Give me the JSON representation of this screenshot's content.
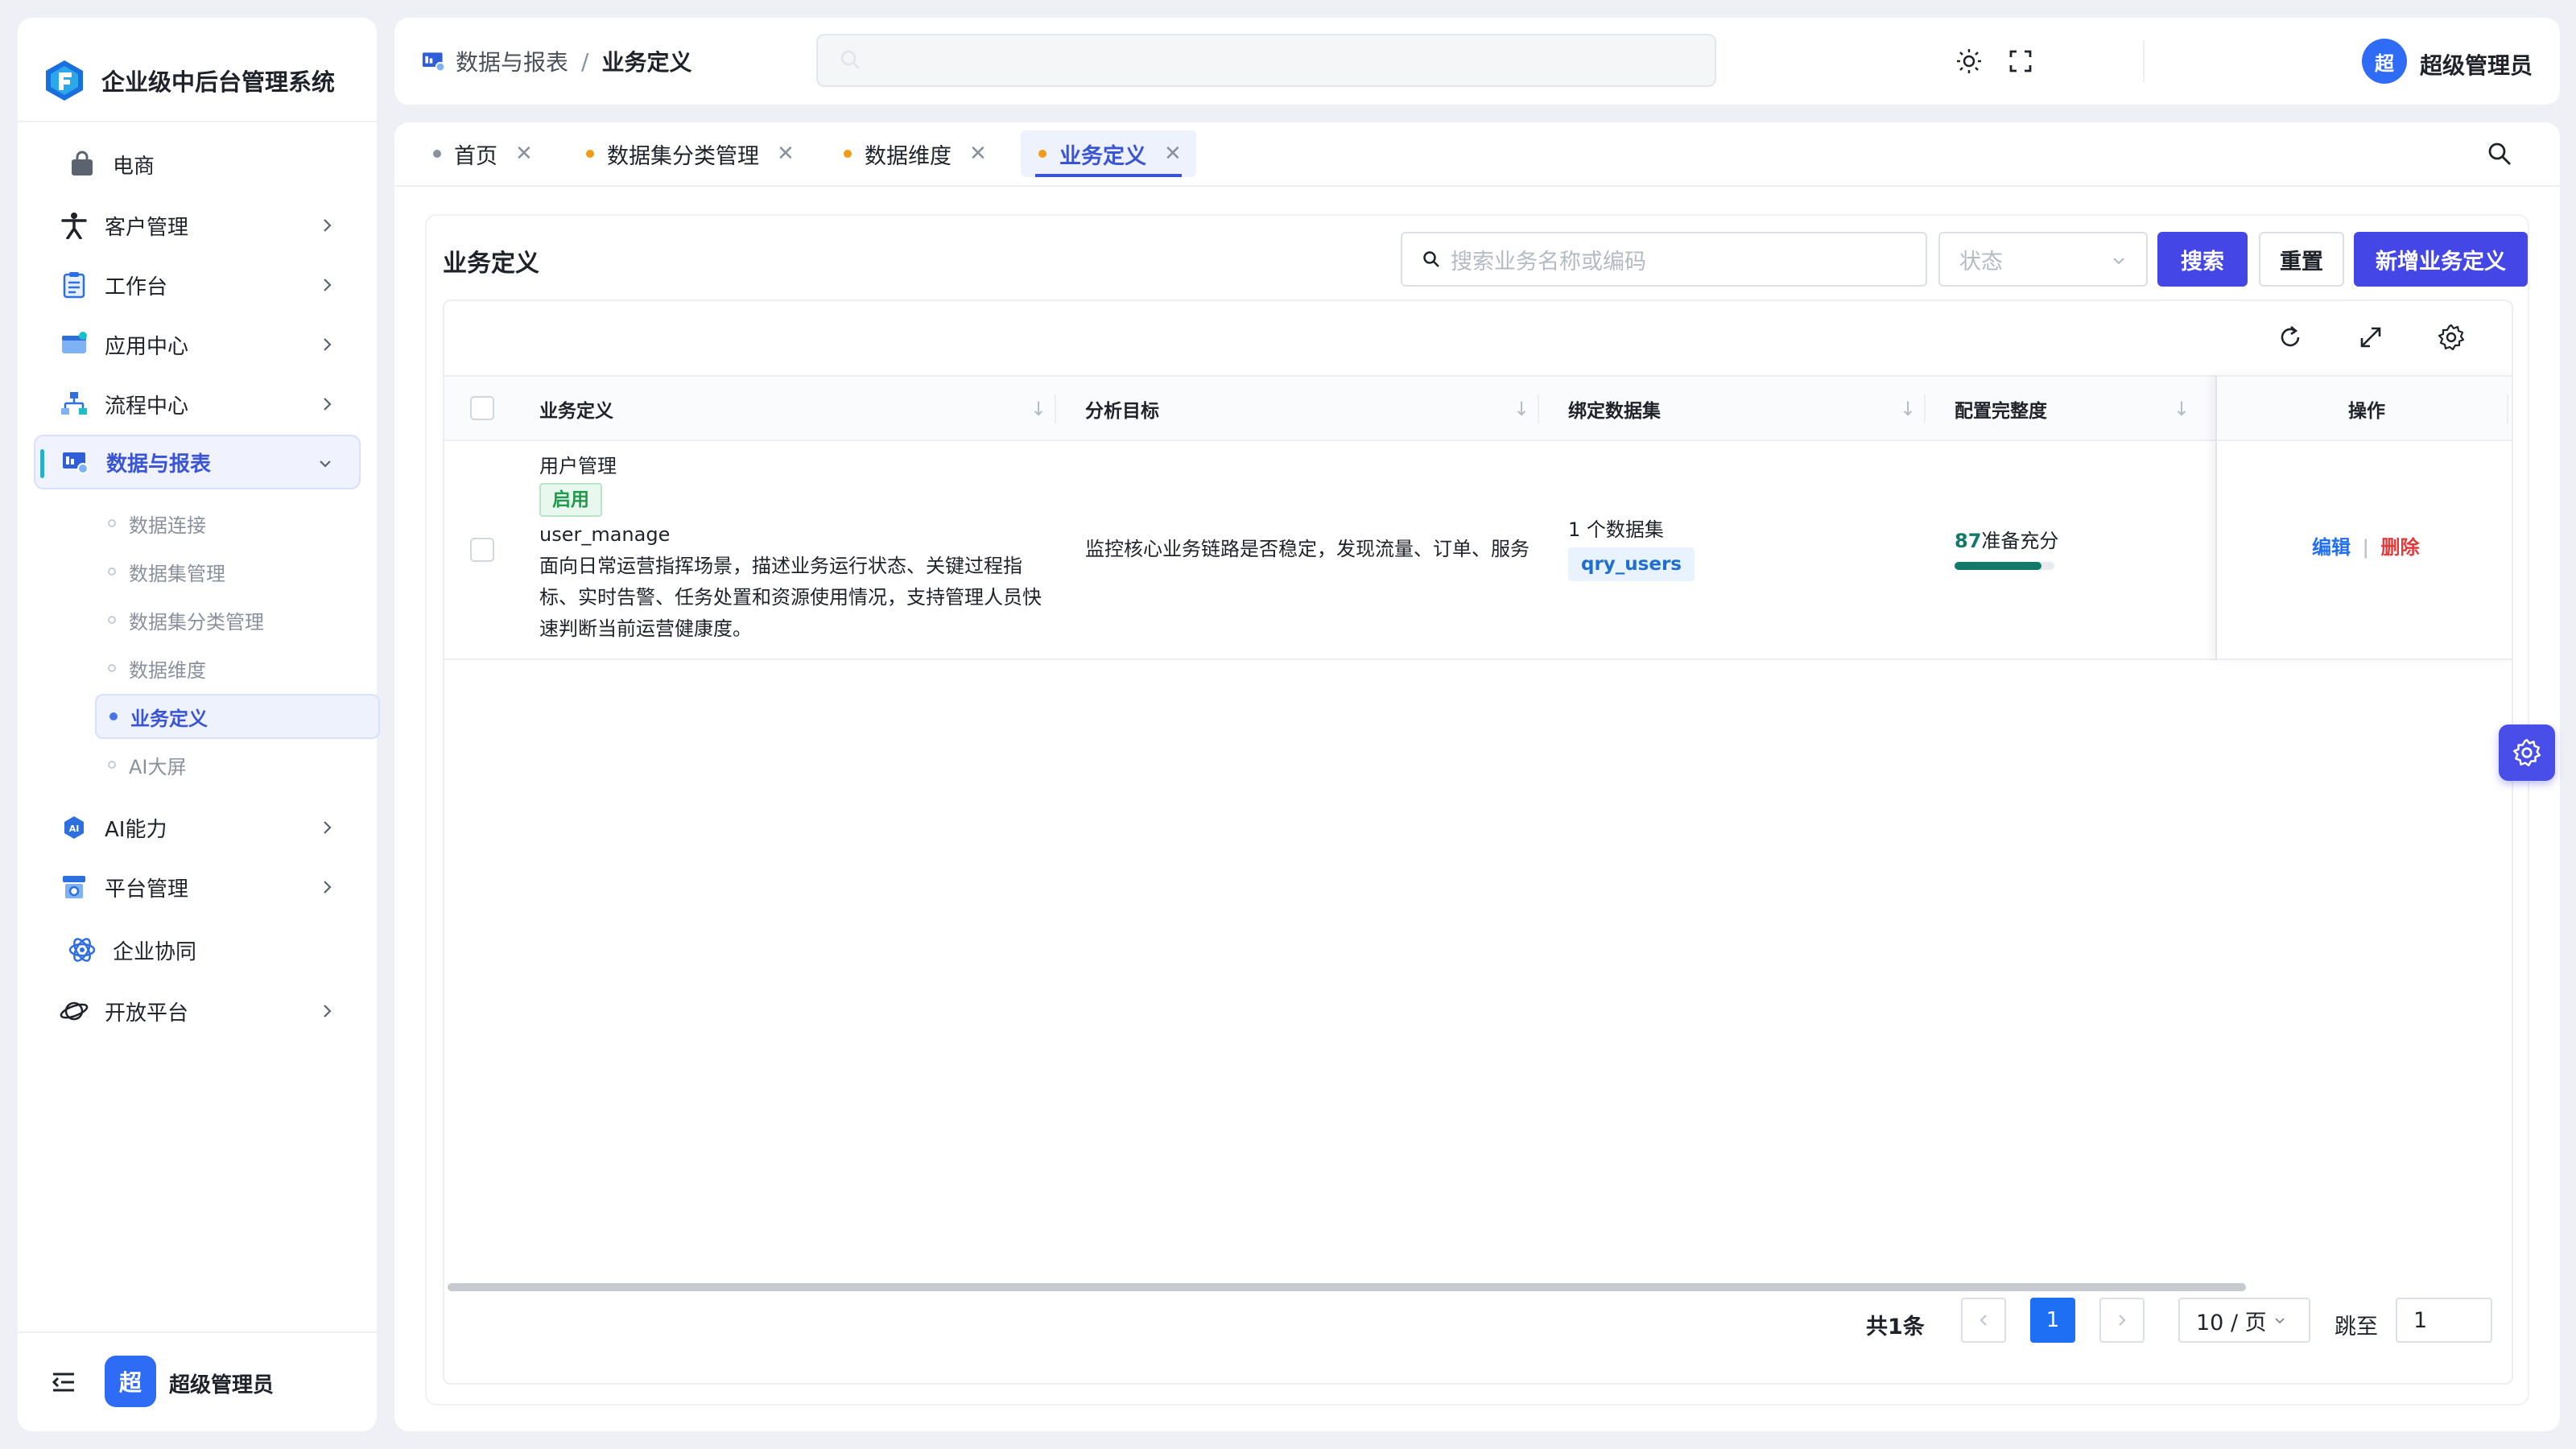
{
  "app": {
    "title": "企业级中后台管理系统"
  },
  "sidebar": {
    "items": [
      {
        "label": "电商",
        "icon": "shopping-bag-icon"
      },
      {
        "label": "客户管理",
        "icon": "person-icon"
      },
      {
        "label": "工作台",
        "icon": "clipboard-icon"
      },
      {
        "label": "应用中心",
        "icon": "app-window-icon"
      },
      {
        "label": "流程中心",
        "icon": "flow-icon"
      },
      {
        "label": "数据与报表",
        "icon": "report-icon"
      },
      {
        "label": "AI能力",
        "icon": "ai-icon"
      },
      {
        "label": "平台管理",
        "icon": "platform-icon"
      },
      {
        "label": "企业协同",
        "icon": "collab-icon"
      },
      {
        "label": "开放平台",
        "icon": "planet-icon"
      }
    ],
    "sub_items": [
      {
        "label": "数据连接"
      },
      {
        "label": "数据集管理"
      },
      {
        "label": "数据集分类管理"
      },
      {
        "label": "数据维度"
      },
      {
        "label": "业务定义"
      },
      {
        "label": "AI大屏"
      }
    ],
    "footer": {
      "avatar_text": "超",
      "user_name": "超级管理员"
    }
  },
  "header": {
    "breadcrumb": {
      "parent": "数据与报表",
      "separator": "/",
      "current": "业务定义"
    },
    "user": {
      "avatar_text": "超",
      "name": "超级管理员"
    }
  },
  "tabs": [
    {
      "label": "首页",
      "dot_color": "#8a919d"
    },
    {
      "label": "数据集分类管理",
      "dot_color": "#f29b16"
    },
    {
      "label": "数据维度",
      "dot_color": "#f29b16"
    },
    {
      "label": "业务定义",
      "dot_color": "#f29b16"
    }
  ],
  "page": {
    "title": "业务定义",
    "search_placeholder": "搜索业务名称或编码",
    "status_placeholder": "状态",
    "search_button": "搜索",
    "reset_button": "重置",
    "add_button": "新增业务定义"
  },
  "table": {
    "columns": [
      "业务定义",
      "分析目标",
      "绑定数据集",
      "配置完整度",
      "操作"
    ],
    "rows": [
      {
        "name": "用户管理",
        "status": "启用",
        "code": "user_manage",
        "desc_lines": [
          "面向日常运营指挥场景，描述业务运行状态、关键过程指",
          "标、实时告警、任务处置和资源使用情况，支持管理人员快",
          "速判断当前运营健康度。"
        ],
        "target": "监控核心业务链路是否稳定，发现流量、订单、服务",
        "dataset_count": "1 个数据集",
        "dataset_tag": "qry_users",
        "score": "87",
        "score_label": "准备充分",
        "score_fraction": 0.87,
        "actions": {
          "edit": "编辑",
          "sep": "|",
          "delete": "删除"
        }
      }
    ]
  },
  "pagination": {
    "total": "共1条",
    "prev": "<",
    "page": "1",
    "next": ">",
    "page_size": "10 / 页",
    "jump_label": "跳至",
    "jump_value": "1"
  },
  "colors": {
    "primary": "#4447e6",
    "link": "#1f6ff5",
    "danger": "#e23a3a",
    "progress": "#137a6a"
  }
}
